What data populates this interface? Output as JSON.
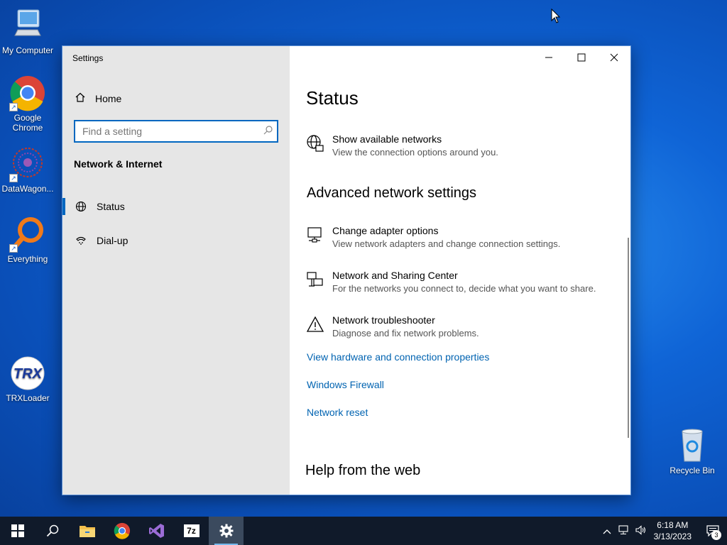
{
  "desktop": {
    "icons": [
      {
        "label": "My Computer",
        "icon": "computer-icon"
      },
      {
        "label": "Google Chrome",
        "icon": "chrome-icon"
      },
      {
        "label": "DataWagon...",
        "icon": "datawagon-icon"
      },
      {
        "label": "Everything",
        "icon": "everything-search-icon"
      },
      {
        "label": "TRXLoader",
        "icon": "trxloader-icon",
        "logo_text": "TRX"
      },
      {
        "label": "Recycle Bin",
        "icon": "recycle-bin-icon"
      }
    ]
  },
  "window": {
    "title": "Settings",
    "sidebar": {
      "home_label": "Home",
      "search_placeholder": "Find a setting",
      "section_label": "Network & Internet",
      "items": [
        {
          "label": "Status",
          "icon": "globe-icon",
          "active": true
        },
        {
          "label": "Dial-up",
          "icon": "dialup-icon",
          "active": false
        }
      ]
    },
    "content": {
      "title": "Status",
      "show_networks": {
        "title": "Show available networks",
        "desc": "View the connection options around you."
      },
      "advanced_heading": "Advanced network settings",
      "settings": [
        {
          "title": "Change adapter options",
          "desc": "View network adapters and change connection settings.",
          "icon": "adapter-icon"
        },
        {
          "title": "Network and Sharing Center",
          "desc": "For the networks you connect to, decide what you want to share.",
          "icon": "sharing-center-icon"
        },
        {
          "title": "Network troubleshooter",
          "desc": "Diagnose and fix network problems.",
          "icon": "warning-icon"
        }
      ],
      "links": [
        "View hardware and connection properties",
        "Windows Firewall",
        "Network reset"
      ],
      "help_heading": "Help from the web"
    }
  },
  "taskbar": {
    "apps": [
      "start-icon",
      "search-icon",
      "file-explorer-icon",
      "chrome-icon",
      "visual-studio-icon",
      "7zip-icon",
      "settings-gear-icon"
    ],
    "sevenzip_label": "7z",
    "time": "6:18 AM",
    "date": "3/13/2023",
    "notification_count": "3"
  },
  "colors": {
    "accent": "#0067c0",
    "link": "#0063b1",
    "sidebar_bg": "#e6e6e6",
    "taskbar_bg": "#101a2a"
  }
}
